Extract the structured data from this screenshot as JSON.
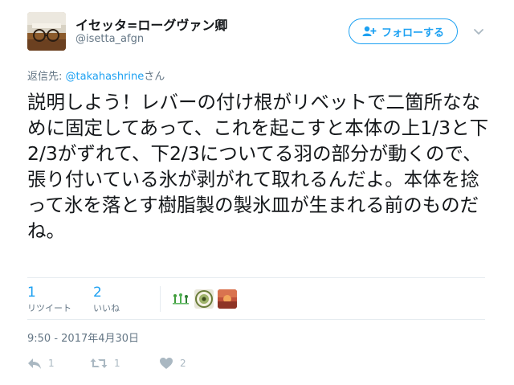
{
  "author": {
    "display_name": "イセッタ=ローグヴァン卿",
    "handle": "@isetta_afgn"
  },
  "follow_button": {
    "label": "フォローする"
  },
  "reply_context": {
    "prefix": "返信先: ",
    "mention": "@takahashrine",
    "suffix": "さん"
  },
  "tweet": {
    "text": "説明しよう！レバーの付け根がリベットで二箇所ななめに固定してあって、これを起こすと本体の上1/3と下2/3がずれて、下2/3についてる羽の部分が動くので、張り付いている氷が剥がれて取れるんだよ。本体を捻って氷を落とす樹脂製の製氷皿が生まれる前のものだね。",
    "timestamp": "9:50 - 2017年4月30日"
  },
  "stats": {
    "retweets": {
      "count": "1",
      "label": "リツイート"
    },
    "likes": {
      "count": "2",
      "label": "いいね"
    }
  },
  "likers": [
    {
      "icon": "green-figures-avatar"
    },
    {
      "icon": "round-badge-avatar"
    },
    {
      "icon": "sunset-avatar"
    }
  ],
  "actions": {
    "reply_count": "1",
    "retweet_count": "1",
    "like_count": "2"
  },
  "colors": {
    "accent": "#1da1f2",
    "secondary_text": "#657786",
    "action_icon": "#aab8c2",
    "divider": "#e6ecf0"
  }
}
